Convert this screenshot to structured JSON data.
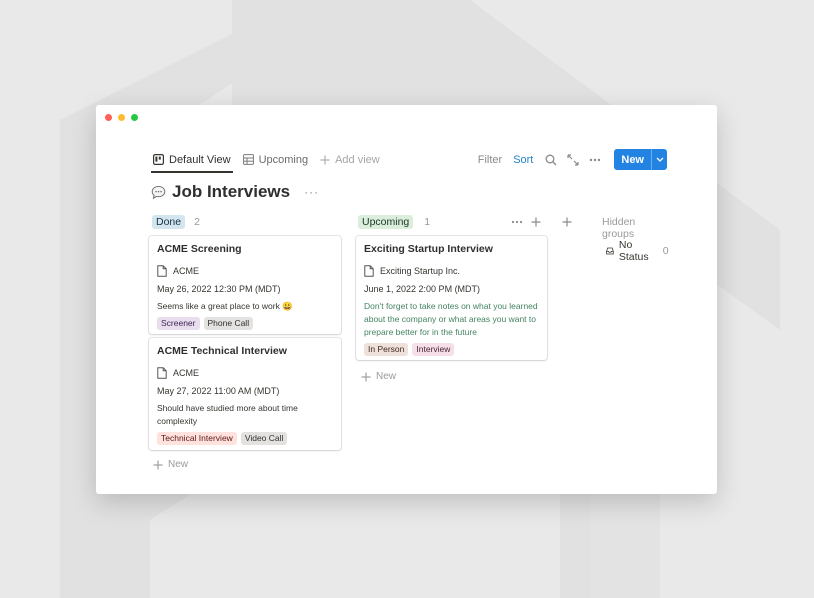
{
  "toolbar": {
    "tabs": [
      {
        "label": "Default View",
        "icon": "board-icon"
      },
      {
        "label": "Upcoming",
        "icon": "table-icon"
      },
      {
        "label": "Add view",
        "icon": "plus-icon"
      }
    ],
    "filter_label": "Filter",
    "sort_label": "Sort",
    "new_label": "New"
  },
  "page": {
    "title": "Job Interviews",
    "emoji": "speech-bubble-icon"
  },
  "columns": [
    {
      "name": "Done",
      "count": "2",
      "cards": [
        {
          "title": "ACME Screening",
          "company": "ACME",
          "date": "May 26, 2022 12:30 PM (MDT)",
          "notes": "Seems like a great place to work 😀",
          "tags": [
            "Screener",
            "Phone Call"
          ]
        },
        {
          "title": "ACME Technical Interview",
          "company": "ACME",
          "date": "May 27, 2022 11:00 AM (MDT)",
          "notes": "Should have studied more about time complexity",
          "tags": [
            "Technical Interview",
            "Video Call"
          ]
        }
      ],
      "new_label": "New"
    },
    {
      "name": "Upcoming",
      "count": "1",
      "cards": [
        {
          "title": "Exciting Startup Interview",
          "company": "Exciting Startup Inc.",
          "date": "June 1, 2022 2:00 PM (MDT)",
          "notes": "Don't forget to take notes on what you learned about the company or what areas you want to prepare better for in the future",
          "tags": [
            "In Person",
            "Interview"
          ]
        }
      ],
      "new_label": "New"
    }
  ],
  "hidden_groups": {
    "label": "Hidden groups",
    "items": [
      {
        "name": "No Status",
        "count": "0"
      }
    ]
  },
  "colors": {
    "accent": "#2383e2",
    "sort": "#2383c4",
    "done_pill": "#d3e5ef",
    "upcoming_pill": "#dbeddb"
  }
}
